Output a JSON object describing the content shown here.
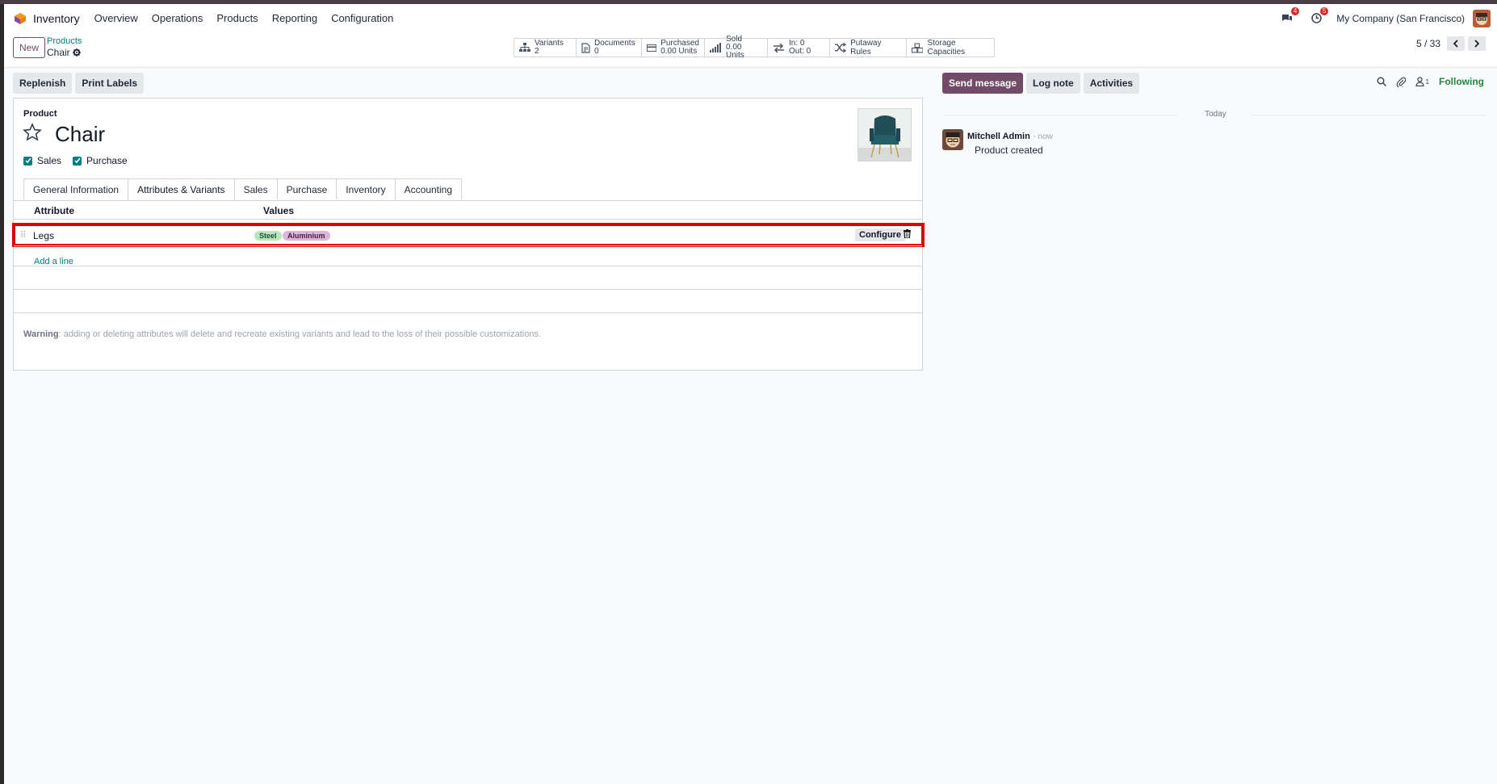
{
  "nav": {
    "app_name": "Inventory",
    "menus": [
      "Overview",
      "Operations",
      "Products",
      "Reporting",
      "Configuration"
    ],
    "messages_count": "4",
    "activities_count": "5",
    "company": "My Company (San Francisco)"
  },
  "control": {
    "new_label": "New",
    "breadcrumb_parent": "Products",
    "breadcrumb_current": "Chair",
    "smart_buttons": {
      "variants_label": "Variants",
      "variants_value": "2",
      "documents_label": "Documents",
      "documents_value": "0",
      "purchased_label": "Purchased",
      "purchased_value": "0.00 Units",
      "sold_label": "Sold",
      "sold_value": "0.00 Units",
      "in_label": "In: 0",
      "out_label": "Out: 0",
      "putaway_label": "Putaway Rules",
      "storage_label": "Storage Capacities"
    },
    "pager": "5 / 33"
  },
  "actions": {
    "replenish": "Replenish",
    "print_labels": "Print Labels"
  },
  "form": {
    "product_label": "Product",
    "product_name": "Chair",
    "sales_label": "Sales",
    "purchase_label": "Purchase",
    "tabs": [
      "General Information",
      "Attributes & Variants",
      "Sales",
      "Purchase",
      "Inventory",
      "Accounting"
    ],
    "active_tab": "Attributes & Variants",
    "columns": {
      "attribute": "Attribute",
      "values": "Values"
    },
    "rows": [
      {
        "attribute": "Legs",
        "values": [
          "Steel",
          "Aluminium"
        ],
        "configure": "Configure"
      }
    ],
    "add_line": "Add a line",
    "warning_bold": "Warning",
    "warning_text": ": adding or deleting attributes will delete and recreate existing variants and lead to the loss of their possible customizations."
  },
  "chatter": {
    "send_message": "Send message",
    "log_note": "Log note",
    "activities": "Activities",
    "followers_count": "1",
    "following": "Following",
    "date_separator": "Today",
    "messages": [
      {
        "author": "Mitchell Admin",
        "time": "- now",
        "body": "Product created"
      }
    ]
  },
  "colors": {
    "brand": "#714b67",
    "accent": "#017e84",
    "highlight": "#e00000",
    "following": "#22863a"
  }
}
